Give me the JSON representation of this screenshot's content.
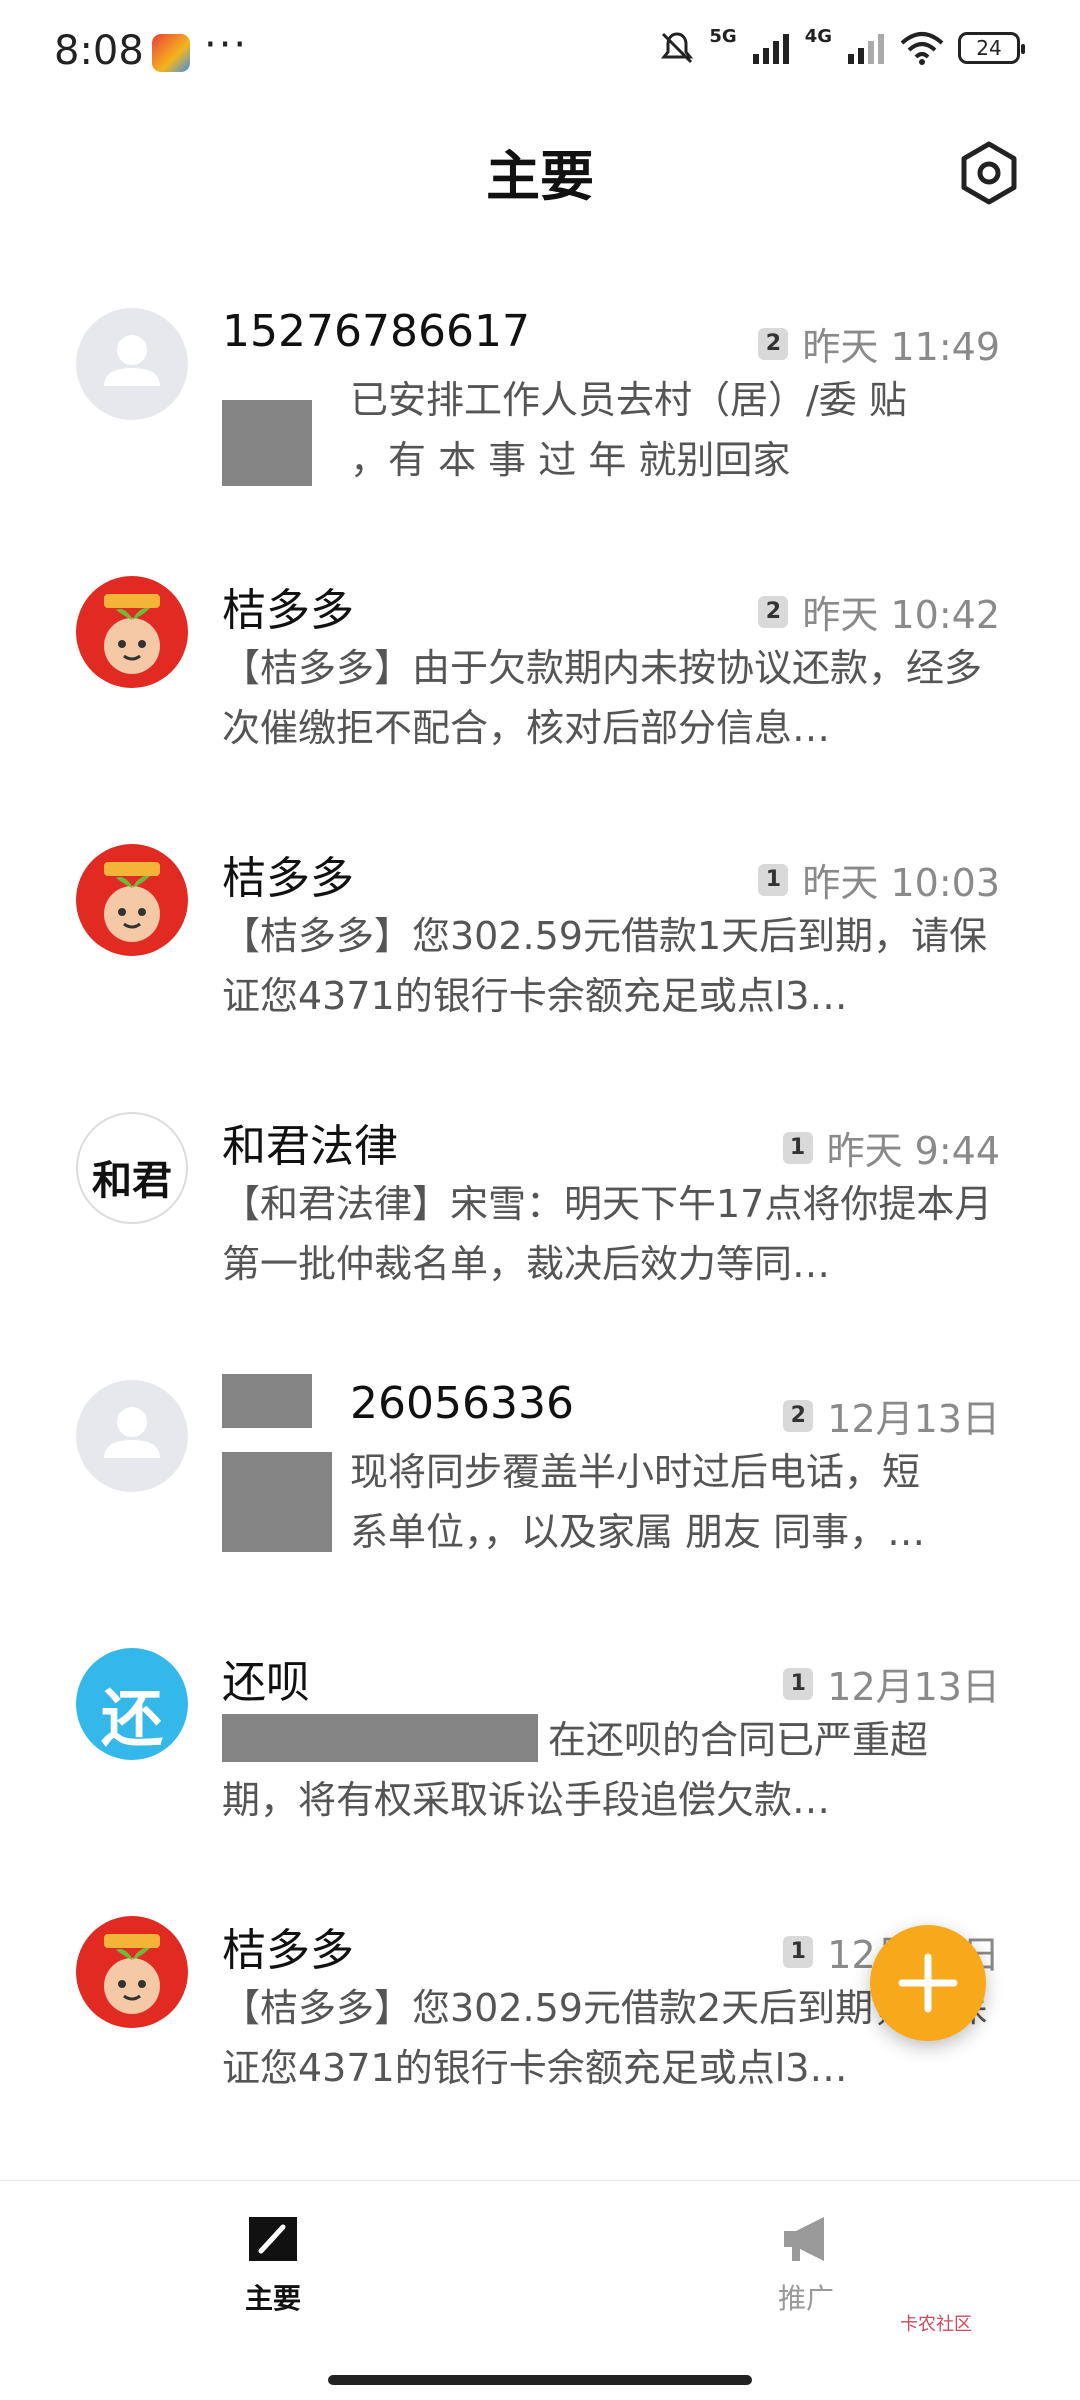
{
  "status_bar": {
    "time": "8:08",
    "more": "···",
    "net1": "5G",
    "net2": "4G",
    "battery": "24"
  },
  "header": {
    "title": "主要"
  },
  "conversations": [
    {
      "name": "15276786617",
      "badge": "2",
      "time": "昨天 11:49",
      "preview_line1": "已安排工作人员去村（居）/委 贴",
      "preview_line2": "，有 本 事 过 年 就别回家"
    },
    {
      "name": "桔多多",
      "badge": "2",
      "time": "昨天 10:42",
      "preview": "【桔多多】由于欠款期内未按协议还款，经多次催缴拒不配合，核对后部分信息…"
    },
    {
      "name": "桔多多",
      "badge": "1",
      "time": "昨天 10:03",
      "preview": "【桔多多】您302.59元借款1天后到期，请保证您4371的银行卡余额充足或点l3…"
    },
    {
      "name": "和君法律",
      "badge": "1",
      "time": "昨天 9:44",
      "preview": "【和君法律】宋雪：明天下午17点将你提本月第一批仲裁名单，裁决后效力等同…",
      "avatar_text": "和君"
    },
    {
      "name": "26056336",
      "badge": "2",
      "time": "12月13日",
      "preview_line1": "现将同步覆盖半小时过后电话，短",
      "preview_line2": "系单位，，以及家属 朋友 同事，…"
    },
    {
      "name": "还呗",
      "badge": "1",
      "time": "12月13日",
      "preview_line1": "在还呗的合同已严重超",
      "preview_line2": "期，将有权采取诉讼手段追偿欠款…",
      "avatar_text": "还"
    },
    {
      "name": "桔多多",
      "badge": "1",
      "time": "12月13日",
      "preview": "【桔多多】您302.59元借款2天后到期，请保证您4371的银行卡余额充足或点l3…"
    }
  ],
  "bottom_nav": {
    "main_label": "主要",
    "promo_label": "推广"
  },
  "watermark": "卡农社区",
  "colors": {
    "fab": "#f7a91b",
    "avatar_red": "#e12b22",
    "avatar_blue": "#34b8ea"
  }
}
